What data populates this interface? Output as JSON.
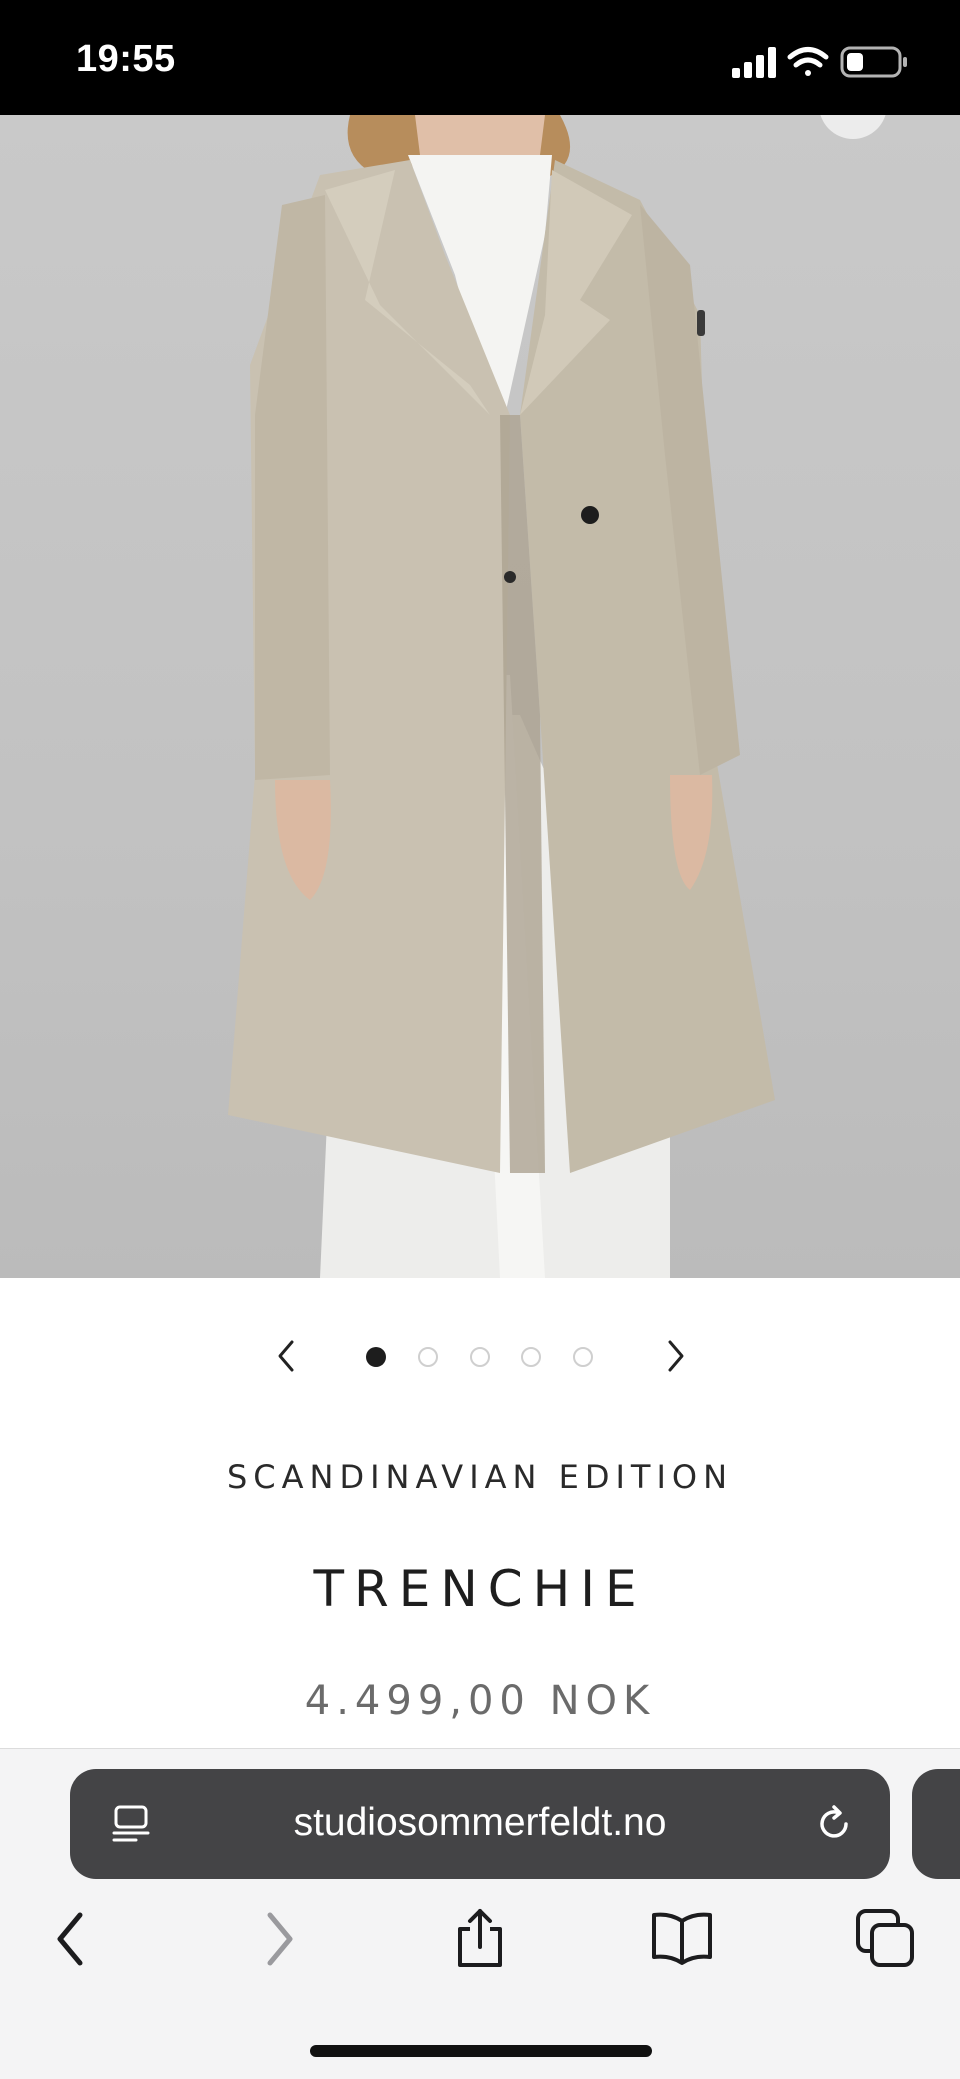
{
  "status_bar": {
    "time": "19:55"
  },
  "carousel": {
    "total_slides": 5,
    "active_index": 0
  },
  "product": {
    "brand": "SCANDINAVIAN EDITION",
    "name": "TRENCHIE",
    "price": "4.499,00 NOK"
  },
  "browser": {
    "url": "studiosommerfeldt.no"
  },
  "icons": {
    "url_left": "page-menu-icon",
    "url_right": "reload-icon",
    "toolbar": [
      "back-icon",
      "forward-icon",
      "share-icon",
      "bookmarks-icon",
      "tabs-icon"
    ]
  },
  "colors": {
    "status_bar_bg": "#000000",
    "url_bar_bg": "#444446",
    "active_dot": "#1d1d1d"
  }
}
